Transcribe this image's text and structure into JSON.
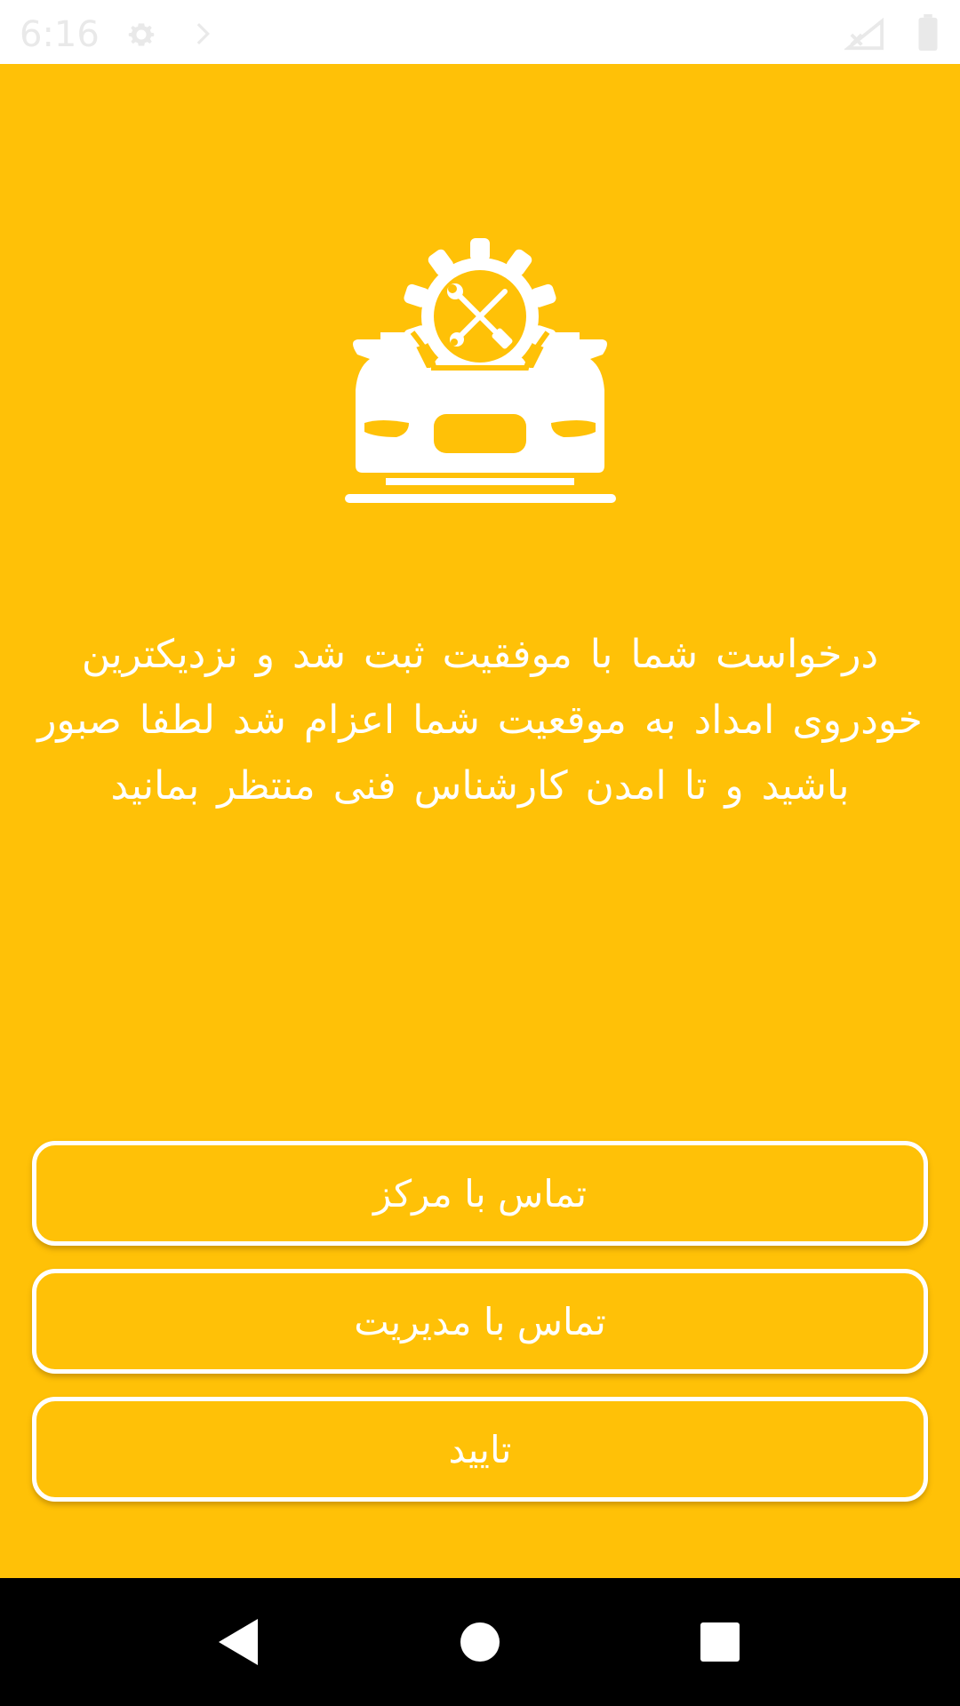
{
  "status_bar": {
    "time": "6:16",
    "icons": [
      "gear-icon",
      "arrow-icon",
      "signal-icon",
      "battery-icon"
    ]
  },
  "logo": {
    "icon": "car-repair-gear-icon"
  },
  "message": {
    "text": "درخواست شما با موفقیت ثبت شد و نزدیکترین خودروی امداد به موقعیت شما اعزام شد لطفا صبور باشید و تا امدن کارشناس فنی منتظر بمانید"
  },
  "buttons": {
    "contact_center": "تماس با مرکز",
    "contact_management": "تماس با مدیریت",
    "confirm": "تایید"
  },
  "nav_bar": {
    "icons": [
      "back-icon",
      "home-icon",
      "recents-icon"
    ]
  },
  "colors": {
    "background": "#FFC107",
    "foreground": "#FFFFFF",
    "nav_background": "#000000"
  }
}
